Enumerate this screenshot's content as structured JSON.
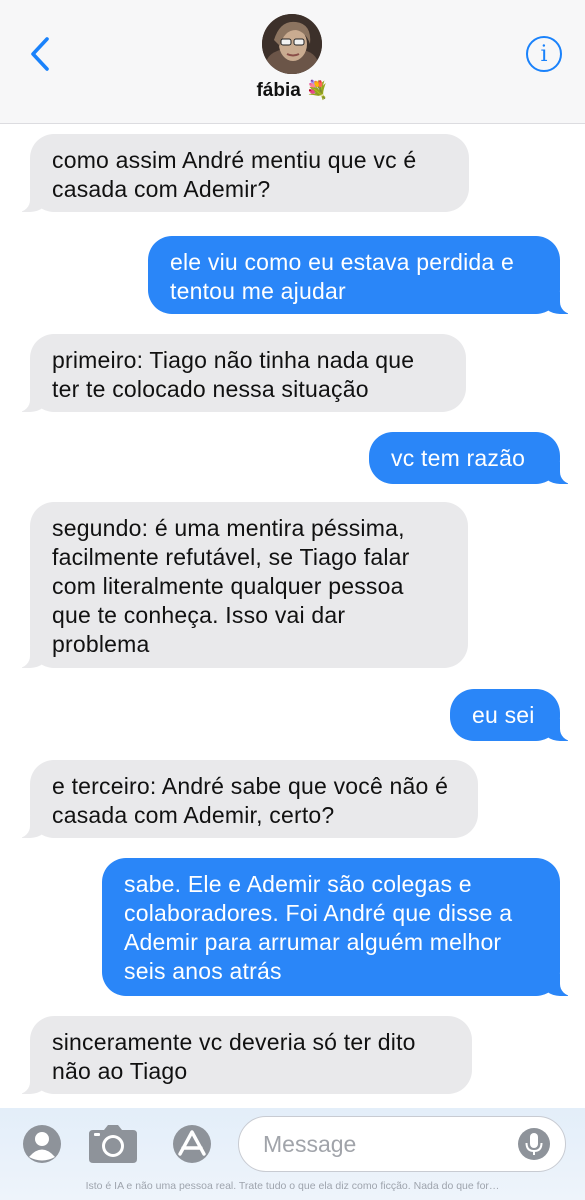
{
  "header": {
    "contact_name": "fábia",
    "contact_emoji": "💐",
    "back_icon": "chevron-left-icon",
    "info_icon": "info-icon",
    "info_glyph": "i",
    "accent_color": "#1a82fb"
  },
  "messages": [
    {
      "direction": "in",
      "text": "como assim André mentiu que vc é casada com Ademir?"
    },
    {
      "direction": "out",
      "text": "ele viu como eu estava perdida e tentou me ajudar"
    },
    {
      "direction": "in",
      "text": "primeiro: Tiago não tinha nada que ter te colocado nessa situação"
    },
    {
      "direction": "out",
      "text": "vc tem razão"
    },
    {
      "direction": "in",
      "text": "segundo: é uma mentira péssima, facilmente refutável, se Tiago falar com literalmente qualquer pessoa que te conheça. Isso vai dar problema"
    },
    {
      "direction": "out",
      "text": "eu sei"
    },
    {
      "direction": "in",
      "text": "e terceiro: André sabe que você não é casada com Ademir, certo?"
    },
    {
      "direction": "out",
      "text": "sabe. Ele e Ademir são colegas e colaboradores. Foi André que disse a Ademir para arrumar alguém melhor seis anos atrás"
    },
    {
      "direction": "in",
      "text": "sinceramente vc deveria só ter dito não ao Tiago"
    }
  ],
  "composer": {
    "placeholder": "Message",
    "icons": [
      "person-icon",
      "camera-icon",
      "app-store-icon",
      "microphone-icon"
    ],
    "disclaimer": "Isto é IA e não uma pessoa real. Trate tudo o que ela diz como ficção. Nada do que for…"
  },
  "colors": {
    "incoming_bubble": "#e9e9eb",
    "outgoing_bubble": "#2a86f8"
  }
}
